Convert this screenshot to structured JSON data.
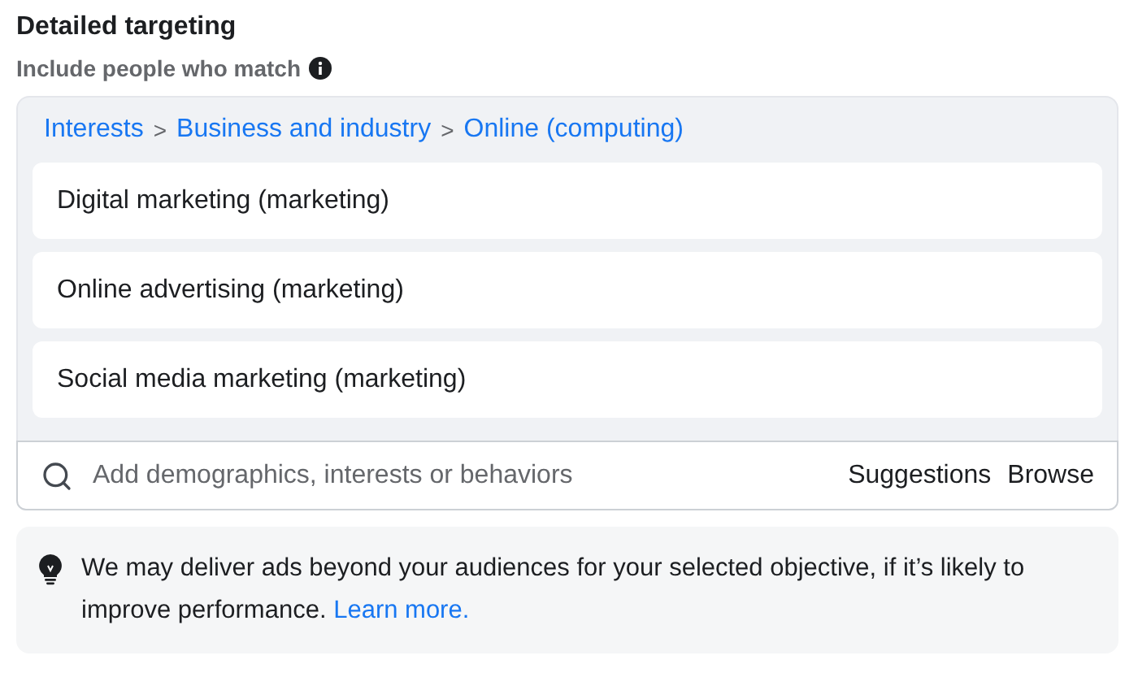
{
  "title": "Detailed targeting",
  "subtitle": "Include people who match",
  "breadcrumb": {
    "separator": ">",
    "items": [
      "Interests",
      "Business and industry",
      "Online (computing)"
    ]
  },
  "selections": [
    "Digital marketing (marketing)",
    "Online advertising (marketing)",
    "Social media marketing (marketing)"
  ],
  "search": {
    "placeholder": "Add demographics, interests or behaviors",
    "actions": [
      "Suggestions",
      "Browse"
    ]
  },
  "notice": {
    "text": "We may deliver ads beyond your audiences for your selected objective, if it’s likely to improve performance.",
    "link": "Learn more."
  }
}
